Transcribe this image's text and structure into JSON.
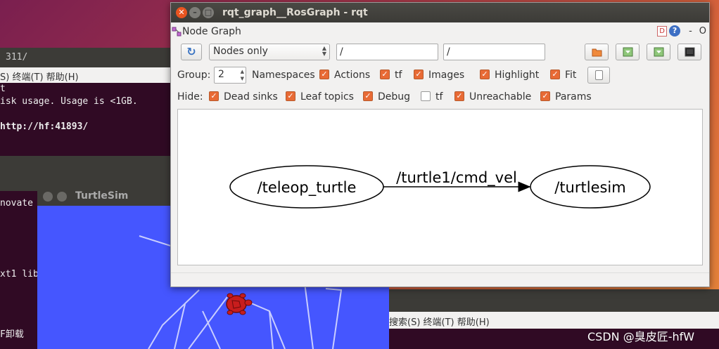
{
  "background_terminal": {
    "path_fragment": "311/",
    "menu": "S)  终端(T)  帮助(H)",
    "lines": [
      "t",
      "isk usage. Usage is <1GB.",
      "",
      " http://hf:41893/"
    ],
    "lower_lines": [
      " novate",
      "xt1 lib",
      "F卸载 "
    ]
  },
  "back_terminal_menu": "搜索(S)  终端(T)  帮助(H)",
  "turtlesim": {
    "title": "TurtleSim"
  },
  "rqt": {
    "window_title": "rqt_graph__RosGraph - rqt",
    "plugin_title": "Node Graph",
    "plugin_right": {
      "d_icon": "D",
      "help_icon": "?",
      "dash": "-",
      "o": "O"
    },
    "toolbar": {
      "refresh_icon": "refresh-icon",
      "mode": "Nodes only",
      "filter1": "/",
      "filter2": "/"
    },
    "group_row": {
      "group_label": "Group:",
      "group_value": "2",
      "namespaces": "Namespaces",
      "actions": "Actions",
      "tf": "tf",
      "images": "Images",
      "highlight": "Highlight",
      "fit": "Fit"
    },
    "hide_row": {
      "hide_label": "Hide:",
      "dead_sinks": "Dead sinks",
      "leaf_topics": "Leaf topics",
      "debug": "Debug",
      "tf": "tf",
      "unreachable": "Unreachable",
      "params": "Params"
    },
    "checked": {
      "namespaces": true,
      "actions": true,
      "tf": true,
      "images": true,
      "highlight": true,
      "fit": true,
      "dead_sinks": true,
      "leaf_topics": true,
      "debug": true,
      "hide_tf": false,
      "unreachable": true,
      "params": true
    },
    "graph": {
      "nodes": [
        {
          "id": "teleop",
          "label": "/teleop_turtle"
        },
        {
          "id": "sim",
          "label": "/turtlesim"
        }
      ],
      "edge": {
        "from": "teleop",
        "to": "sim",
        "label": "/turtle1/cmd_vel"
      }
    }
  },
  "watermark": "CSDN @臭皮匠-hfW",
  "colors": {
    "checkbox": "#e86a35",
    "turtlesim_bg": "#4556ff",
    "terminal_bg": "#300a24",
    "close_button": "#e95420"
  }
}
